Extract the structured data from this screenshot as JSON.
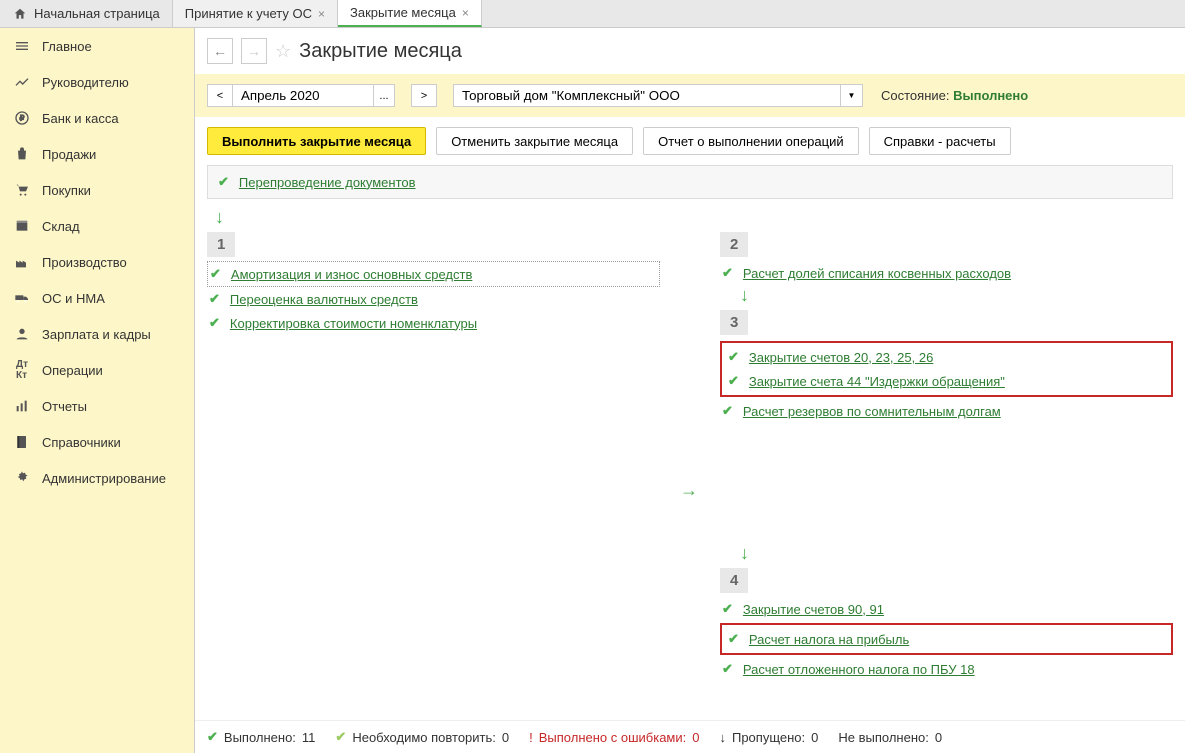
{
  "tabs": {
    "home": "Начальная страница",
    "t1": "Принятие к учету ОС",
    "t2": "Закрытие месяца"
  },
  "sidebar": {
    "items": [
      {
        "label": "Главное"
      },
      {
        "label": "Руководителю"
      },
      {
        "label": "Банк и касса"
      },
      {
        "label": "Продажи"
      },
      {
        "label": "Покупки"
      },
      {
        "label": "Склад"
      },
      {
        "label": "Производство"
      },
      {
        "label": "ОС и НМА"
      },
      {
        "label": "Зарплата и кадры"
      },
      {
        "label": "Операции"
      },
      {
        "label": "Отчеты"
      },
      {
        "label": "Справочники"
      },
      {
        "label": "Администрирование"
      }
    ]
  },
  "header": {
    "title": "Закрытие месяца"
  },
  "toolbar": {
    "prev": "<",
    "period": "Апрель 2020",
    "ellipsis": "...",
    "next": ">",
    "company": "Торговый дом \"Комплексный\" ООО",
    "state_label": "Состояние:",
    "state_value": "Выполнено"
  },
  "buttons": {
    "run": "Выполнить закрытие месяца",
    "cancel": "Отменить закрытие месяца",
    "report": "Отчет о выполнении операций",
    "refs": "Справки - расчеты"
  },
  "repost": {
    "label": "Перепроведение документов"
  },
  "blocks": {
    "b1": {
      "num": "1",
      "ops": [
        "Амортизация и износ основных средств",
        "Переоценка валютных средств",
        "Корректировка стоимости номенклатуры"
      ]
    },
    "b2": {
      "num": "2",
      "ops": [
        "Расчет долей списания косвенных расходов"
      ]
    },
    "b3": {
      "num": "3",
      "ops": [
        "Закрытие счетов 20, 23, 25, 26",
        "Закрытие счета 44 \"Издержки обращения\"",
        "Расчет резервов по сомнительным долгам"
      ]
    },
    "b4": {
      "num": "4",
      "ops": [
        "Закрытие счетов 90, 91",
        "Расчет налога на прибыль",
        "Расчет отложенного налога по ПБУ 18"
      ]
    }
  },
  "status": {
    "done_label": "Выполнено:",
    "done_count": "11",
    "repeat_label": "Необходимо повторить:",
    "repeat_count": "0",
    "errors_label": "Выполнено с ошибками:",
    "errors_count": "0",
    "skipped_label": "Пропущено:",
    "skipped_count": "0",
    "notdone_label": "Не выполнено:",
    "notdone_count": "0"
  }
}
